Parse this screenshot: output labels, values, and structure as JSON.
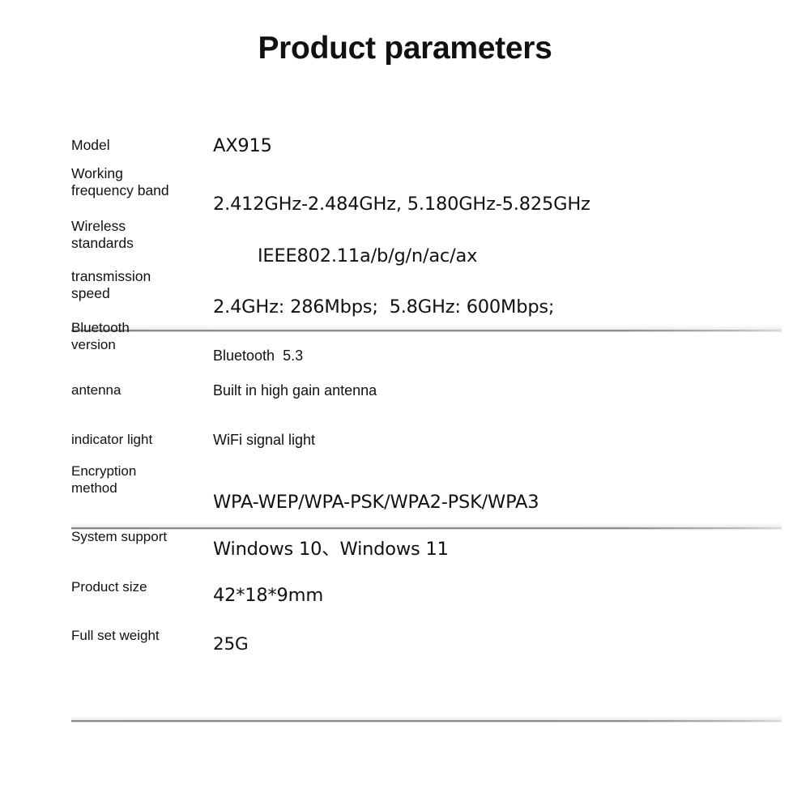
{
  "header": {
    "title": "Product parameters"
  },
  "spec_table": {
    "rows": [
      {
        "label": "Model",
        "value": "AX915"
      },
      {
        "label": "Working\nfrequency band",
        "value": "2.412GHz-2.484GHz, 5.180GHz-5.825GHz"
      },
      {
        "label": "Wireless\nstandards",
        "value": "IEEE802.11a/b/g/n/ac/ax"
      },
      {
        "label": "transmission\nspeed",
        "value": "2.4GHz: 286Mbps;  5.8GHz: 600Mbps;"
      },
      {
        "label": "Bluetooth\nversion",
        "value": "Bluetooth  5.3"
      },
      {
        "label": "antenna",
        "value": "Built in high gain antenna"
      },
      {
        "label": "indicator light",
        "value": "WiFi signal light"
      },
      {
        "label": "Encryption\nmethod",
        "value": "WPA-WEP/WPA-PSK/WPA2-PSK/WPA3"
      },
      {
        "label": "System support",
        "value": "Windows 10、Windows 11"
      },
      {
        "label": "Product size",
        "value": "42*18*9mm"
      },
      {
        "label": "Full set weight",
        "value": "25G"
      }
    ]
  },
  "style": {
    "background_color": "#ffffff",
    "text_color": "#111111",
    "divider_color": "#8a8a8a"
  }
}
